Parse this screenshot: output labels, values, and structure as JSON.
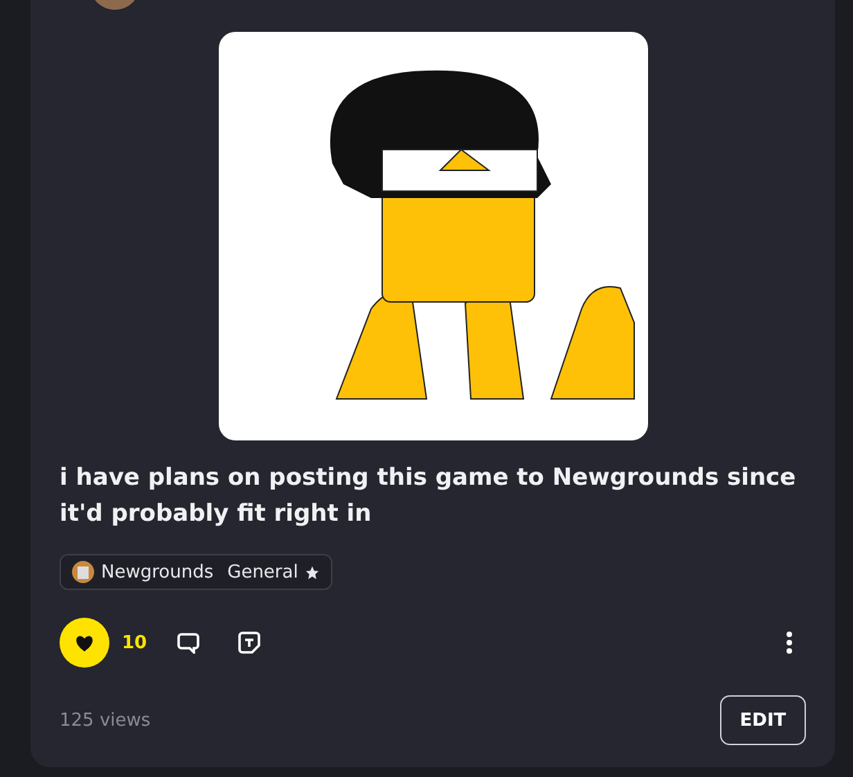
{
  "post": {
    "text": "i have plans on posting this game to Newgrounds since it'd probably fit right in",
    "tags": [
      {
        "kind": "community",
        "label": "Newgrounds"
      },
      {
        "kind": "category",
        "label": "General",
        "starred": true
      }
    ],
    "like": {
      "liked": true,
      "count": "10"
    },
    "views": "125 views",
    "edit_button": "EDIT"
  }
}
